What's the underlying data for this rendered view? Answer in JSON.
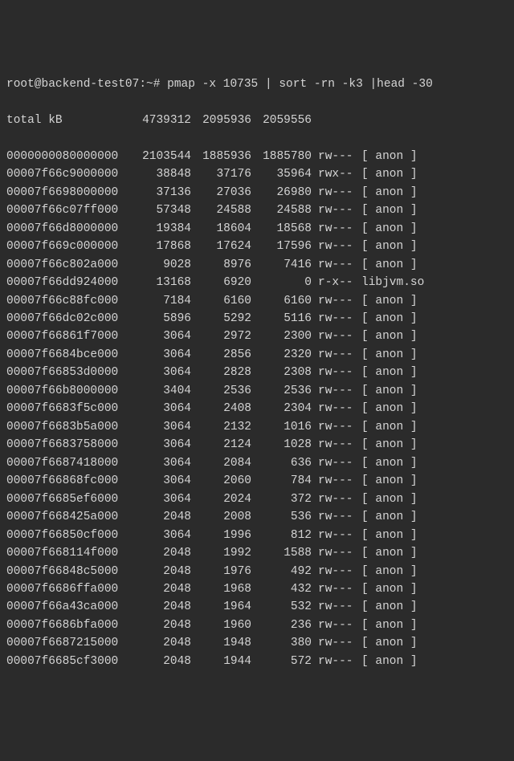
{
  "prompt": "root@backend-test07:~# pmap -x 10735 | sort -rn -k3 |head -30",
  "total": {
    "label": "total kB",
    "kbytes": "4739312",
    "rss": "2095936",
    "dirty": "2059556"
  },
  "rows": [
    {
      "addr": "0000000080000000",
      "kb": "2103544",
      "rss": "1885936",
      "dirty": "1885780",
      "mode": "rw---",
      "map": "[ anon ]"
    },
    {
      "addr": "00007f66c9000000",
      "kb": "38848",
      "rss": "37176",
      "dirty": "35964",
      "mode": "rwx--",
      "map": "[ anon ]"
    },
    {
      "addr": "00007f6698000000",
      "kb": "37136",
      "rss": "27036",
      "dirty": "26980",
      "mode": "rw---",
      "map": "[ anon ]"
    },
    {
      "addr": "00007f66c07ff000",
      "kb": "57348",
      "rss": "24588",
      "dirty": "24588",
      "mode": "rw---",
      "map": "[ anon ]"
    },
    {
      "addr": "00007f66d8000000",
      "kb": "19384",
      "rss": "18604",
      "dirty": "18568",
      "mode": "rw---",
      "map": "[ anon ]"
    },
    {
      "addr": "00007f669c000000",
      "kb": "17868",
      "rss": "17624",
      "dirty": "17596",
      "mode": "rw---",
      "map": "[ anon ]"
    },
    {
      "addr": "00007f66c802a000",
      "kb": "9028",
      "rss": "8976",
      "dirty": "7416",
      "mode": "rw---",
      "map": "[ anon ]"
    },
    {
      "addr": "00007f66dd924000",
      "kb": "13168",
      "rss": "6920",
      "dirty": "0",
      "mode": "r-x--",
      "map": "libjvm.so"
    },
    {
      "addr": "00007f66c88fc000",
      "kb": "7184",
      "rss": "6160",
      "dirty": "6160",
      "mode": "rw---",
      "map": "[ anon ]"
    },
    {
      "addr": "00007f66dc02c000",
      "kb": "5896",
      "rss": "5292",
      "dirty": "5116",
      "mode": "rw---",
      "map": "[ anon ]"
    },
    {
      "addr": "00007f66861f7000",
      "kb": "3064",
      "rss": "2972",
      "dirty": "2300",
      "mode": "rw---",
      "map": "[ anon ]"
    },
    {
      "addr": "00007f6684bce000",
      "kb": "3064",
      "rss": "2856",
      "dirty": "2320",
      "mode": "rw---",
      "map": "[ anon ]"
    },
    {
      "addr": "00007f66853d0000",
      "kb": "3064",
      "rss": "2828",
      "dirty": "2308",
      "mode": "rw---",
      "map": "[ anon ]"
    },
    {
      "addr": "00007f66b8000000",
      "kb": "3404",
      "rss": "2536",
      "dirty": "2536",
      "mode": "rw---",
      "map": "[ anon ]"
    },
    {
      "addr": "00007f6683f5c000",
      "kb": "3064",
      "rss": "2408",
      "dirty": "2304",
      "mode": "rw---",
      "map": "[ anon ]"
    },
    {
      "addr": "00007f6683b5a000",
      "kb": "3064",
      "rss": "2132",
      "dirty": "1016",
      "mode": "rw---",
      "map": "[ anon ]"
    },
    {
      "addr": "00007f6683758000",
      "kb": "3064",
      "rss": "2124",
      "dirty": "1028",
      "mode": "rw---",
      "map": "[ anon ]"
    },
    {
      "addr": "00007f6687418000",
      "kb": "3064",
      "rss": "2084",
      "dirty": "636",
      "mode": "rw---",
      "map": "[ anon ]"
    },
    {
      "addr": "00007f66868fc000",
      "kb": "3064",
      "rss": "2060",
      "dirty": "784",
      "mode": "rw---",
      "map": "[ anon ]"
    },
    {
      "addr": "00007f6685ef6000",
      "kb": "3064",
      "rss": "2024",
      "dirty": "372",
      "mode": "rw---",
      "map": "[ anon ]"
    },
    {
      "addr": "00007f668425a000",
      "kb": "2048",
      "rss": "2008",
      "dirty": "536",
      "mode": "rw---",
      "map": "[ anon ]"
    },
    {
      "addr": "00007f66850cf000",
      "kb": "3064",
      "rss": "1996",
      "dirty": "812",
      "mode": "rw---",
      "map": "[ anon ]"
    },
    {
      "addr": "00007f668114f000",
      "kb": "2048",
      "rss": "1992",
      "dirty": "1588",
      "mode": "rw---",
      "map": "[ anon ]"
    },
    {
      "addr": "00007f66848c5000",
      "kb": "2048",
      "rss": "1976",
      "dirty": "492",
      "mode": "rw---",
      "map": "[ anon ]"
    },
    {
      "addr": "00007f6686ffa000",
      "kb": "2048",
      "rss": "1968",
      "dirty": "432",
      "mode": "rw---",
      "map": "[ anon ]"
    },
    {
      "addr": "00007f66a43ca000",
      "kb": "2048",
      "rss": "1964",
      "dirty": "532",
      "mode": "rw---",
      "map": "[ anon ]"
    },
    {
      "addr": "00007f6686bfa000",
      "kb": "2048",
      "rss": "1960",
      "dirty": "236",
      "mode": "rw---",
      "map": "[ anon ]"
    },
    {
      "addr": "00007f6687215000",
      "kb": "2048",
      "rss": "1948",
      "dirty": "380",
      "mode": "rw---",
      "map": "[ anon ]"
    },
    {
      "addr": "00007f6685cf3000",
      "kb": "2048",
      "rss": "1944",
      "dirty": "572",
      "mode": "rw---",
      "map": "[ anon ]"
    }
  ]
}
